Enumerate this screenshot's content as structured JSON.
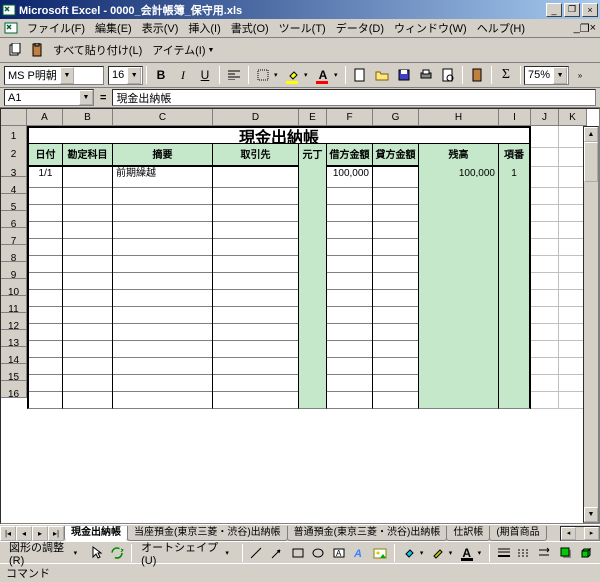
{
  "title": "Microsoft Excel - 0000_会計帳簿_保守用.xls",
  "menu": {
    "file": "ファイル(F)",
    "edit": "編集(E)",
    "view": "表示(V)",
    "insert": "挿入(I)",
    "format": "書式(O)",
    "tools": "ツール(T)",
    "data": "データ(D)",
    "window": "ウィンドウ(W)",
    "help": "ヘルプ(H)"
  },
  "toolbar": {
    "paste_all": "すべて貼り付け(L)",
    "items": "アイテム(I)"
  },
  "format": {
    "font": "MS P明朝",
    "size": "16",
    "zoom": "75%"
  },
  "namebox": "A1",
  "formula": "現金出納帳",
  "colheads": [
    "A",
    "B",
    "C",
    "D",
    "E",
    "F",
    "G",
    "H",
    "I",
    "J",
    "K"
  ],
  "sheet_title": "現金出納帳",
  "headers": {
    "date": "日付",
    "account": "勘定科目",
    "summary": "摘要",
    "partner": "取引先",
    "moto": "元丁",
    "debit": "借方金額",
    "credit": "貸方金額",
    "balance": "残高",
    "item": "項番"
  },
  "rows": [
    {
      "n": "3",
      "date": "1/1",
      "account": "",
      "summary": "前期繰越",
      "partner": "",
      "moto": "",
      "debit": "100,000",
      "credit": "",
      "balance": "100,000",
      "item": "1"
    },
    {
      "n": "4"
    },
    {
      "n": "5"
    },
    {
      "n": "6"
    },
    {
      "n": "7"
    },
    {
      "n": "8"
    },
    {
      "n": "9"
    },
    {
      "n": "10"
    },
    {
      "n": "11"
    },
    {
      "n": "12"
    },
    {
      "n": "13"
    },
    {
      "n": "14"
    },
    {
      "n": "15"
    },
    {
      "n": "16"
    }
  ],
  "tabs": [
    "現金出納帳",
    "当座預金(東京三菱・渋谷)出納帳",
    "普通預金(東京三菱・渋谷)出納帳",
    "仕訳帳",
    "(期首商品"
  ],
  "drawbar": {
    "adjust": "図形の調整(R)",
    "autoshape": "オートシェイプ(U)"
  },
  "status": "コマンド"
}
